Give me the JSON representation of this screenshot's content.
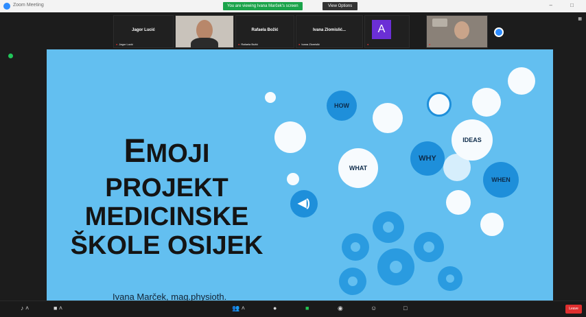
{
  "window": {
    "app_title": "Zoom Meeting",
    "share_banner": "You are viewing Ivana Marček's screen",
    "view_options_label": "View Options"
  },
  "participants": [
    {
      "name": "Jagor Lucić",
      "label": "Jagor Lucić",
      "muted": true,
      "video": false
    },
    {
      "name": "",
      "label": "",
      "muted": false,
      "video": true
    },
    {
      "name": "Rafaela Božić",
      "label": "Rafaela Božić",
      "muted": true,
      "video": false
    },
    {
      "name": "Ivana Zlomislić...",
      "label": "Ivana Zlomislić",
      "muted": true,
      "video": false
    },
    {
      "name": "A",
      "label": "",
      "muted": true,
      "video": false,
      "avatar": true
    },
    {
      "name": "",
      "label": "",
      "muted": true,
      "video": true
    }
  ],
  "slide": {
    "title_line1_first": "E",
    "title_line1_rest": "MOJI",
    "title_line2": "PROJEKT",
    "title_line3": "MEDICINSKE",
    "title_line4": "ŠKOLE OSIJEK",
    "author": "Ivana Marček, mag.physioth.",
    "bubbles": {
      "how": "HOW",
      "what": "WHAT",
      "why": "WHY",
      "ideas": "IDEAS",
      "when": "WHEN"
    }
  },
  "colors": {
    "slide_bg": "#63bff0",
    "accent_blue": "#1e8fda",
    "zoom_blue": "#2d8cff",
    "end_red": "#e02f2f",
    "banner_green": "#1aa34a"
  },
  "toolbar": {
    "mic_icon": "microphone-icon",
    "video_icon": "video-camera-icon",
    "participants_icon": "participants-icon",
    "chat_icon": "chat-icon",
    "share_icon": "share-screen-icon",
    "record_icon": "record-icon",
    "reactions_icon": "reactions-icon",
    "more_icon": "more-icon",
    "end_label": "Leave"
  }
}
